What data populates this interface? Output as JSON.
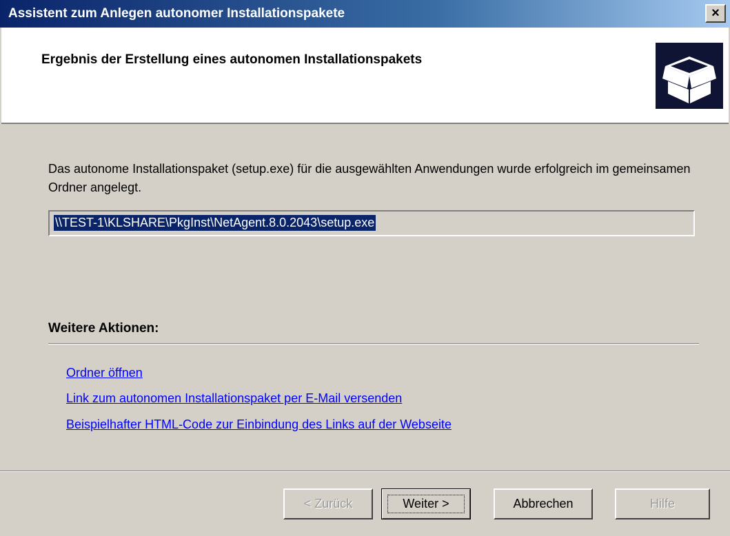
{
  "window": {
    "title": "Assistent zum Anlegen autonomer Installationspakete",
    "close_glyph": "×"
  },
  "header": {
    "title": "Ergebnis der Erstellung eines autonomen Installationspakets",
    "logo_icon": "open-box-icon"
  },
  "content": {
    "description": "Das autonome Installationspaket (setup.exe) für die ausgewählten Anwendungen wurde erfolgreich im gemeinsamen Ordner angelegt.",
    "path": "\\\\TEST-1\\KLSHARE\\PkgInst\\NetAgent.8.0.2043\\setup.exe"
  },
  "actions": {
    "label": "Weitere Aktionen:",
    "links": [
      "Ordner öffnen",
      "Link zum autonomen Installationspaket per E-Mail versenden",
      "Beispielhafter HTML-Code zur Einbindung des Links auf der Webseite"
    ]
  },
  "buttons": {
    "back": "< Zurück",
    "next": "Weiter >",
    "cancel": "Abbrechen",
    "help": "Hilfe"
  },
  "colors": {
    "titlebar_start": "#0a246a",
    "titlebar_end": "#a6caf0",
    "face": "#d4d0c8",
    "link": "#0000ff",
    "selection": "#0a246a"
  }
}
